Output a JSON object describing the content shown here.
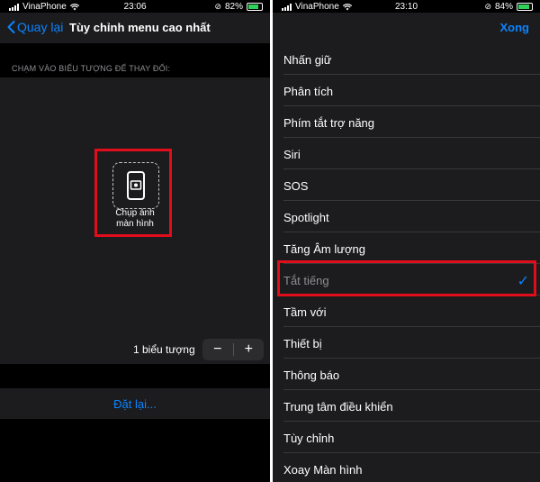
{
  "left": {
    "status": {
      "carrier": "VinaPhone",
      "time": "23:06",
      "battery": "82%"
    },
    "nav": {
      "back_label": "Quay lại",
      "title": "Tùy chỉnh menu cao nhất"
    },
    "section_header": "CHẠM VÀO BIỂU TƯỢNG ĐỂ THAY ĐỔI:",
    "icon": {
      "label_line1": "Chụp ảnh",
      "label_line2": "màn hình",
      "icon": "screenshot-phone-icon"
    },
    "count": {
      "label": "1 biểu tượng",
      "minus": "−",
      "plus": "+"
    },
    "reset_label": "Đặt lại..."
  },
  "right": {
    "status": {
      "carrier": "VinaPhone",
      "time": "23:10",
      "battery": "84%"
    },
    "nav": {
      "done_label": "Xong"
    },
    "items": [
      {
        "label": "Nhấn giữ"
      },
      {
        "label": "Phân tích"
      },
      {
        "label": "Phím tắt trợ năng"
      },
      {
        "label": "Siri"
      },
      {
        "label": "SOS"
      },
      {
        "label": "Spotlight"
      },
      {
        "label": "Tăng Âm lượng"
      },
      {
        "label": "Tắt tiếng",
        "checked": "✓"
      },
      {
        "label": "Tầm với"
      },
      {
        "label": "Thiết bị"
      },
      {
        "label": "Thông báo"
      },
      {
        "label": "Trung tâm điều khiển"
      },
      {
        "label": "Tùy chỉnh"
      },
      {
        "label": "Xoay Màn hình"
      }
    ]
  },
  "colors": {
    "accent": "#0a84ff",
    "highlight": "#e00d1b",
    "battery": "#30d158"
  }
}
